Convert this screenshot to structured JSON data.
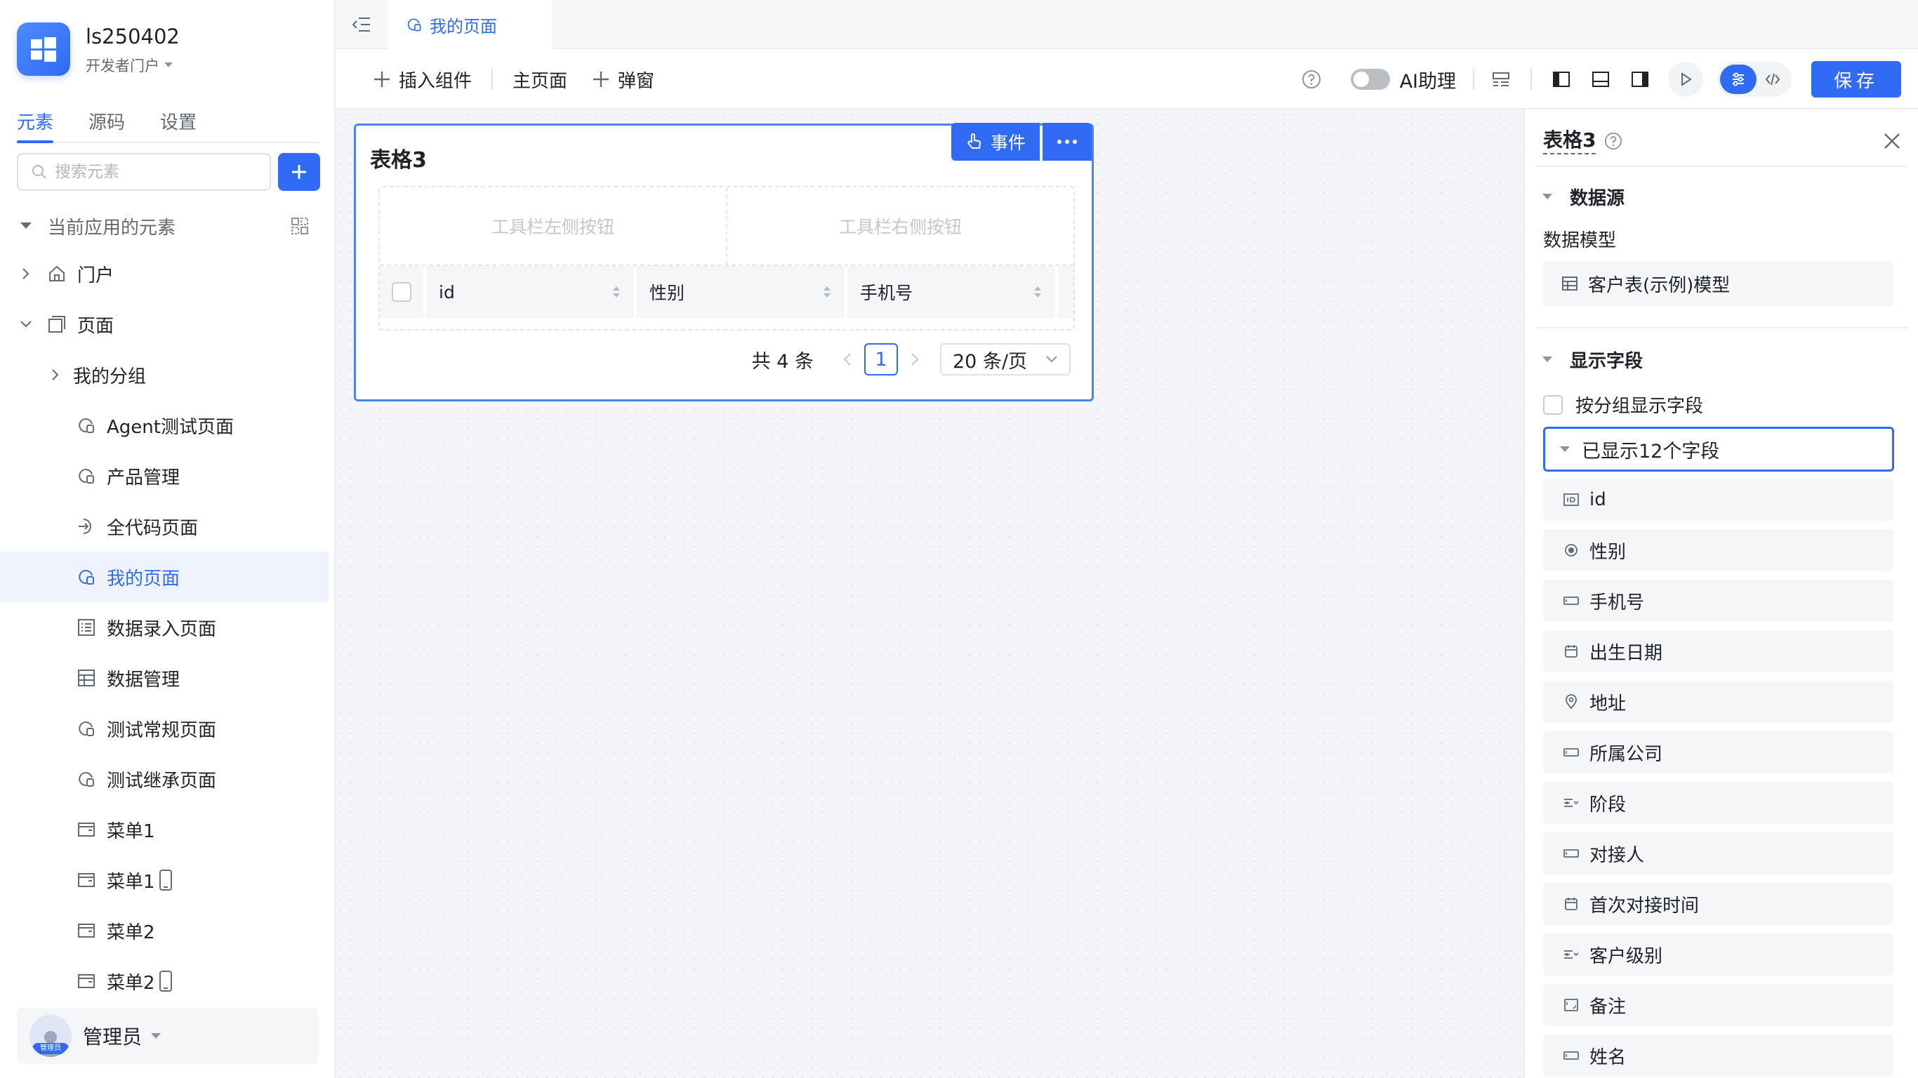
{
  "app": {
    "name": "ls250402",
    "role": "开发者门户"
  },
  "sidebar": {
    "tabs": [
      {
        "label": "元素",
        "active": true
      },
      {
        "label": "源码",
        "active": false
      },
      {
        "label": "设置",
        "active": false
      }
    ],
    "search_placeholder": "搜索元素",
    "section_label": "当前应用的元素",
    "tree": [
      {
        "label": "门户",
        "icon": "home-icon",
        "level": 0,
        "expanded": false
      },
      {
        "label": "页面",
        "icon": "pages-icon",
        "level": 0,
        "expanded": true
      },
      {
        "label": "我的分组",
        "icon": "",
        "level": 1,
        "expanded": false
      },
      {
        "label": "Agent测试页面",
        "icon": "page-brush-icon",
        "level": 2
      },
      {
        "label": "产品管理",
        "icon": "page-brush-icon",
        "level": 2
      },
      {
        "label": "全代码页面",
        "icon": "code-page-icon",
        "level": 2
      },
      {
        "label": "我的页面",
        "icon": "page-brush-icon",
        "level": 2,
        "selected": true
      },
      {
        "label": "数据录入页面",
        "icon": "form-page-icon",
        "level": 2
      },
      {
        "label": "数据管理",
        "icon": "table-page-icon",
        "level": 2
      },
      {
        "label": "测试常规页面",
        "icon": "page-brush-icon",
        "level": 2
      },
      {
        "label": "测试继承页面",
        "icon": "page-brush-icon",
        "level": 2
      },
      {
        "label": "菜单1",
        "icon": "menu-page-icon",
        "level": 2
      },
      {
        "label": "菜单1",
        "icon": "menu-page-icon",
        "level": 2,
        "mobile": true
      },
      {
        "label": "菜单2",
        "icon": "menu-page-icon",
        "level": 2
      },
      {
        "label": "菜单2",
        "icon": "menu-page-icon",
        "level": 2,
        "mobile": true
      }
    ],
    "user": {
      "name": "管理员",
      "badge": "管理员"
    }
  },
  "tabbar": {
    "active_tab": "我的页面"
  },
  "toolbar": {
    "insert_component": "插入组件",
    "main_page": "主页面",
    "popup": "弹窗",
    "ai_assistant": "AI助理",
    "ai_enabled": false,
    "save": "保存"
  },
  "widget": {
    "title": "表格3",
    "event_label": "事件",
    "toolbar_left": "工具栏左侧按钮",
    "toolbar_right": "工具栏右侧按钮",
    "columns": [
      "id",
      "性别",
      "手机号"
    ],
    "pager": {
      "total": "共 4 条",
      "page": "1",
      "page_size": "20 条/页"
    }
  },
  "panel": {
    "title": "表格3",
    "datasource_section": "数据源",
    "data_model_label": "数据模型",
    "data_model_value": "客户表(示例)模型",
    "fields_section": "显示字段",
    "group_by_label": "按分组显示字段",
    "shown_summary": "已显示12个字段",
    "fields": [
      {
        "label": "id",
        "icon": "id-icon"
      },
      {
        "label": "性别",
        "icon": "radio-icon"
      },
      {
        "label": "手机号",
        "icon": "input-icon"
      },
      {
        "label": "出生日期",
        "icon": "date-icon"
      },
      {
        "label": "地址",
        "icon": "location-icon"
      },
      {
        "label": "所属公司",
        "icon": "input-icon"
      },
      {
        "label": "阶段",
        "icon": "select-icon"
      },
      {
        "label": "对接人",
        "icon": "input-icon"
      },
      {
        "label": "首次对接时间",
        "icon": "date-icon"
      },
      {
        "label": "客户级别",
        "icon": "select-icon"
      },
      {
        "label": "备注",
        "icon": "textarea-icon"
      },
      {
        "label": "姓名",
        "icon": "input-icon"
      }
    ]
  }
}
